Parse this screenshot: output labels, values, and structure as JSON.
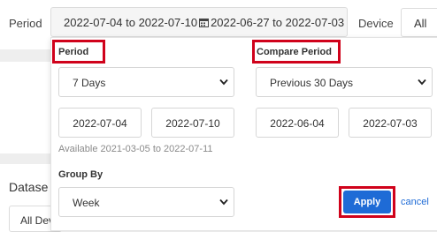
{
  "header": {
    "period_label": "Period",
    "current_range": "2022-07-04 to 2022-07-10",
    "compare_range": "2022-06-27 to 2022-07-03",
    "device_label": "Device",
    "device_value": "All"
  },
  "background": {
    "dataset_label": "Datase",
    "dataset_value": "All Dev"
  },
  "popup": {
    "period": {
      "label": "Period",
      "preset": "7 Days",
      "start": "2022-07-04",
      "end": "2022-07-10",
      "available": "Available 2021-03-05 to 2022-07-11"
    },
    "compare": {
      "label": "Compare Period",
      "preset": "Previous 30 Days",
      "start": "2022-06-04",
      "end": "2022-07-03"
    },
    "group_by": {
      "label": "Group By",
      "value": "Week"
    },
    "apply_label": "Apply",
    "cancel_label": "cancel"
  },
  "colors": {
    "highlight": "#d0021b",
    "primary": "#1e6bd6"
  }
}
